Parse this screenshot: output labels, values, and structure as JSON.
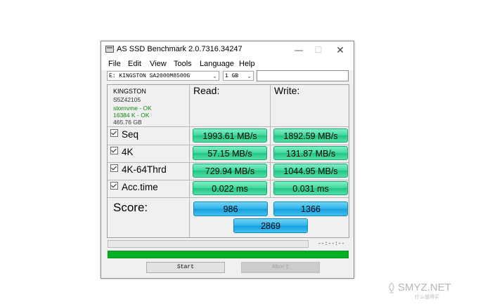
{
  "window": {
    "title": "AS SSD Benchmark 2.0.7316.34247",
    "buttons": {
      "minimize": "—",
      "maximize": "☐",
      "close": "✕"
    }
  },
  "menu": [
    "File",
    "Edit",
    "View",
    "Tools",
    "Language",
    "Help"
  ],
  "toolbar": {
    "drive_select": "E: KINGSTON SA2000M8500G",
    "size_select": "1 GB",
    "extra_field_value": ""
  },
  "drive_info": {
    "model": "KINGSTON",
    "firmware": "S5Z42105",
    "driver_status": "stornvme - OK",
    "alignment_status": "16384 K - OK",
    "capacity": "465.76 GB"
  },
  "columns": {
    "read": "Read:",
    "write": "Write:"
  },
  "results": [
    {
      "label": "Seq",
      "read": "1993.61 MB/s",
      "write": "1892.59 MB/s",
      "checked": true
    },
    {
      "label": "4K",
      "read": "57.15 MB/s",
      "write": "131.87 MB/s",
      "checked": true
    },
    {
      "label": "4K-64Thrd",
      "read": "729.94 MB/s",
      "write": "1044.95 MB/s",
      "checked": true
    },
    {
      "label": "Acc.time",
      "read": "0.022 ms",
      "write": "0.031 ms",
      "checked": true
    }
  ],
  "score": {
    "label": "Score:",
    "read": "986",
    "write": "1366",
    "total": "2869"
  },
  "progress": {
    "elapsed": "--:--:--",
    "fraction": 1.0
  },
  "buttons": {
    "start": "Start",
    "abort": "Abort"
  },
  "watermark": {
    "text": "SMYZ.NET",
    "sub": "什么值得买"
  },
  "colors": {
    "result_green": "#3fd79b",
    "score_blue": "#2fb3ea",
    "progress_green": "#06b025"
  }
}
